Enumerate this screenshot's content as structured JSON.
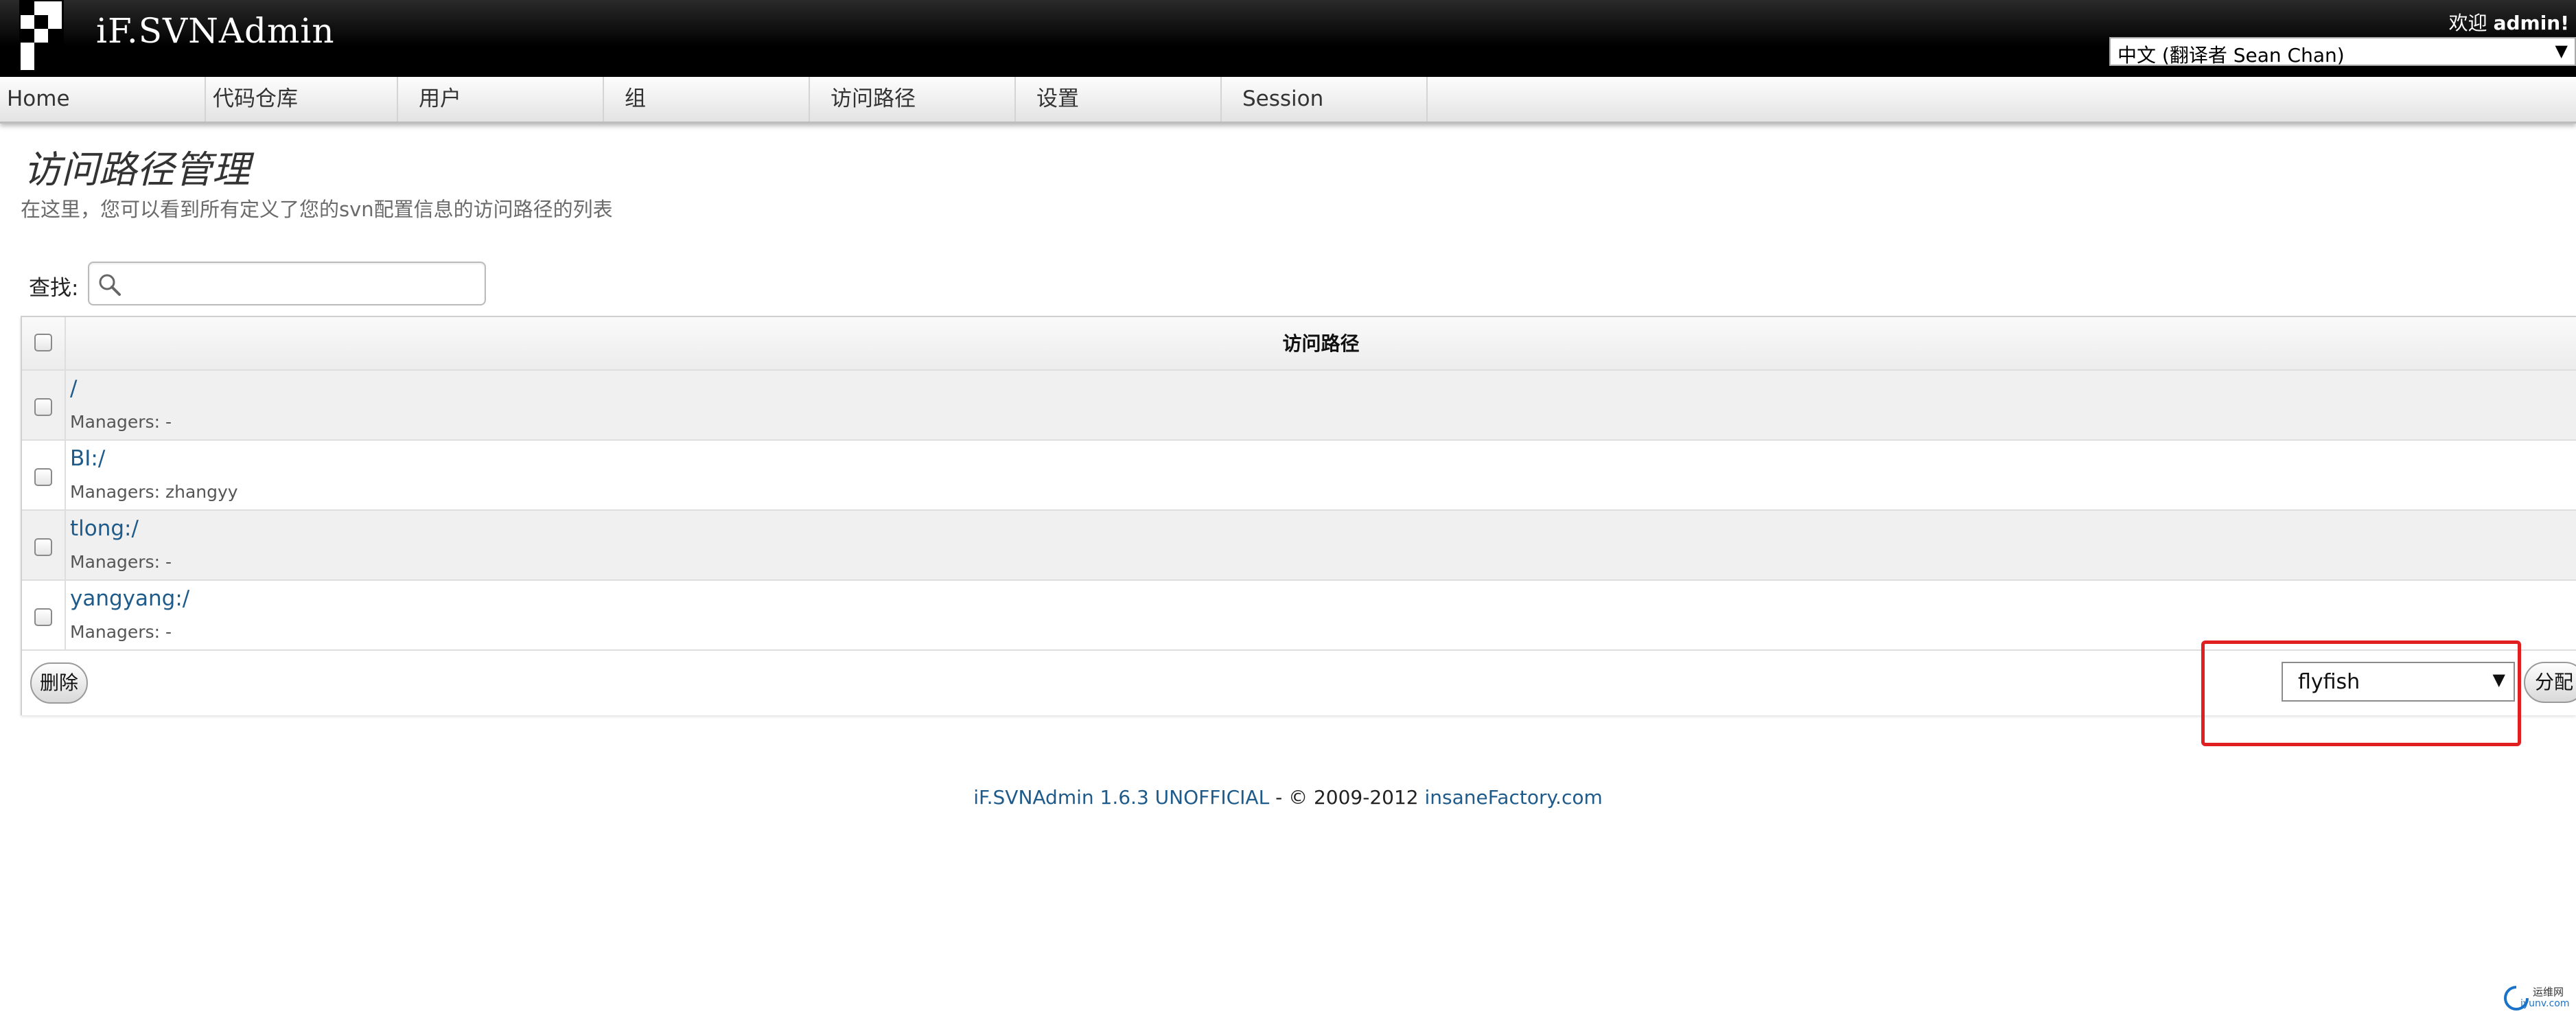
{
  "header": {
    "app_title": "iF.SVNAdmin",
    "welcome_prefix": "欢迎",
    "welcome_user": "admin!",
    "language_selected": "中文 (翻译者 Sean Chan)"
  },
  "nav": {
    "items": [
      {
        "label": "Home"
      },
      {
        "label": "代码仓库"
      },
      {
        "label": "用户"
      },
      {
        "label": "组"
      },
      {
        "label": "访问路径"
      },
      {
        "label": "设置"
      },
      {
        "label": "Session"
      }
    ]
  },
  "page": {
    "title": "访问路径管理",
    "description": "在这里，您可以看到所有定义了您的svn配置信息的访问路径的列表"
  },
  "search": {
    "label": "查找:",
    "value": ""
  },
  "table": {
    "column_header": "访问路径",
    "rows": [
      {
        "path": "/",
        "managers": "Managers: -"
      },
      {
        "path": "BI:/",
        "managers": "Managers: zhangyy"
      },
      {
        "path": "tlong:/",
        "managers": "Managers: -"
      },
      {
        "path": "yangyang:/",
        "managers": "Managers: -"
      }
    ],
    "delete_label": "删除",
    "assign_select_value": "flyfish",
    "assign_label": "分配"
  },
  "footer": {
    "product": "iF.SVNAdmin 1.6.3 UNOFFICIAL",
    "copyright": " - © 2009-2012 ",
    "company": "insaneFactory.com"
  },
  "watermark": {
    "line1": "运维网",
    "line2": "iyunv.com"
  },
  "colors": {
    "header_bg": "#000000",
    "link": "#1e5b8a",
    "highlight": "#e02020"
  }
}
